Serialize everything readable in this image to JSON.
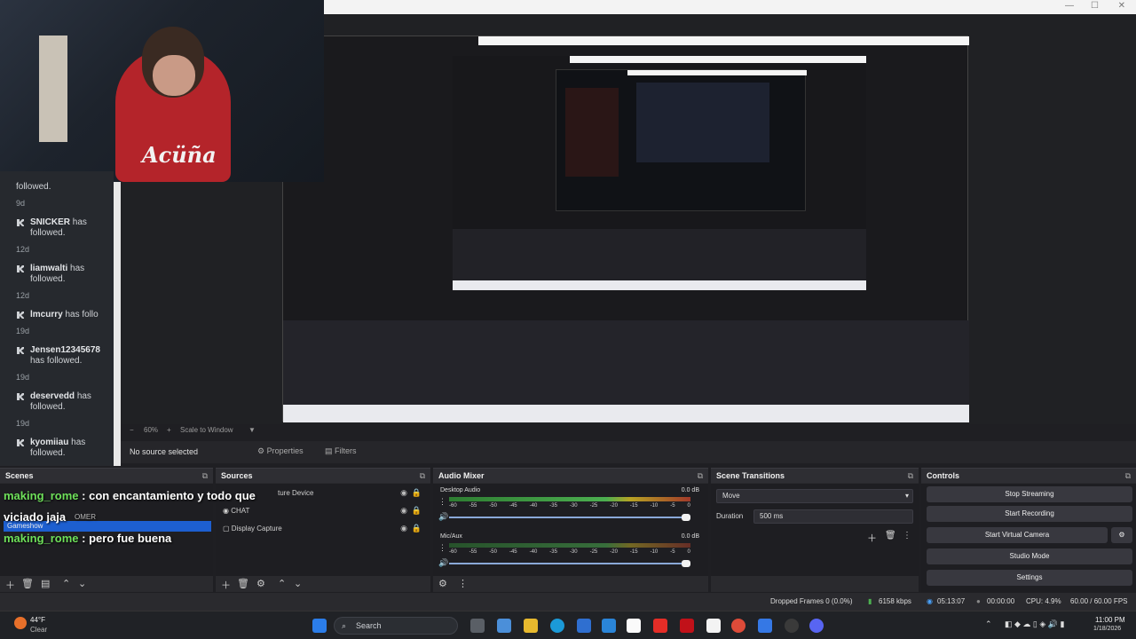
{
  "follows": [
    {
      "name": "SNICKER",
      "text": "has followed.",
      "age": "12d"
    },
    {
      "name": "liamwalti",
      "text": "has followed.",
      "age": "12d"
    },
    {
      "name": "lmcurry",
      "text": "has follo",
      "age": "19d"
    },
    {
      "name": "Jensen12345678",
      "text": "has followed.",
      "age": "19d"
    },
    {
      "name": "deservedd",
      "text": "has followed.",
      "age": "19d"
    },
    {
      "name": "kyomiiau",
      "text": "has followed.",
      "age": "19d"
    }
  ],
  "follow_top": {
    "text": "followed.",
    "age": "9d"
  },
  "preview": {
    "zoom": "60%",
    "scale": "Scale to Window"
  },
  "source_bar": {
    "no_source": "No source selected",
    "properties": "Properties",
    "filters": "Filters"
  },
  "docks": {
    "scenes": "Scenes",
    "sources": "Sources",
    "audio_mixer": "Audio Mixer",
    "scene_transitions": "Scene Transitions",
    "controls": "Controls"
  },
  "scene_list": {
    "selected": "Gameshow"
  },
  "chat_overlay": [
    {
      "user": "making_rome",
      "sep": " : ",
      "msg": "con encantamiento y todo que"
    },
    {
      "user": "",
      "sep": "",
      "msg": "viciado jaja"
    },
    {
      "user": "making_rome",
      "sep": " : ",
      "msg": "pero fue buena"
    }
  ],
  "sources": [
    {
      "name": "ture Device",
      "icon": "camera-icon"
    },
    {
      "name": "CHAT",
      "icon": "browser-icon"
    },
    {
      "name": "Display Capture",
      "icon": "monitor-icon"
    }
  ],
  "sources_extra": "OMER",
  "mixer": {
    "tracks": [
      {
        "name": "Desktop Audio",
        "db": "0.0 dB",
        "level": 0.92
      },
      {
        "name": "Mic/Aux",
        "db": "0.0 dB",
        "level": 0.82
      }
    ],
    "ticks": [
      "-60",
      "-55",
      "-50",
      "-45",
      "-40",
      "-35",
      "-30",
      "-25",
      "-20",
      "-15",
      "-10",
      "-5",
      "0"
    ]
  },
  "transitions": {
    "type": "Move",
    "duration_label": "Duration",
    "duration": "500 ms"
  },
  "controls": [
    "Stop Streaming",
    "Start Recording",
    "Start Virtual Camera",
    "Studio Mode",
    "Settings"
  ],
  "status": {
    "dropped": "Dropped Frames 0 (0.0%)",
    "kbps": "6158 kbps",
    "time": "05:13:07",
    "rec": "00:00:00",
    "cpu": "CPU: 4.9%",
    "fps": "60.00 / 60.00 FPS"
  },
  "taskbar": {
    "weather_temp": "44°F",
    "weather_text": "Clear",
    "search": "Search",
    "time": "11:00 PM",
    "date": "1/18/2026"
  },
  "colors": {
    "accent": "#1d5fd0",
    "chat_user": "#6ee05a",
    "meter_green": "#4caf50",
    "meter_red": "#a23a2a"
  }
}
